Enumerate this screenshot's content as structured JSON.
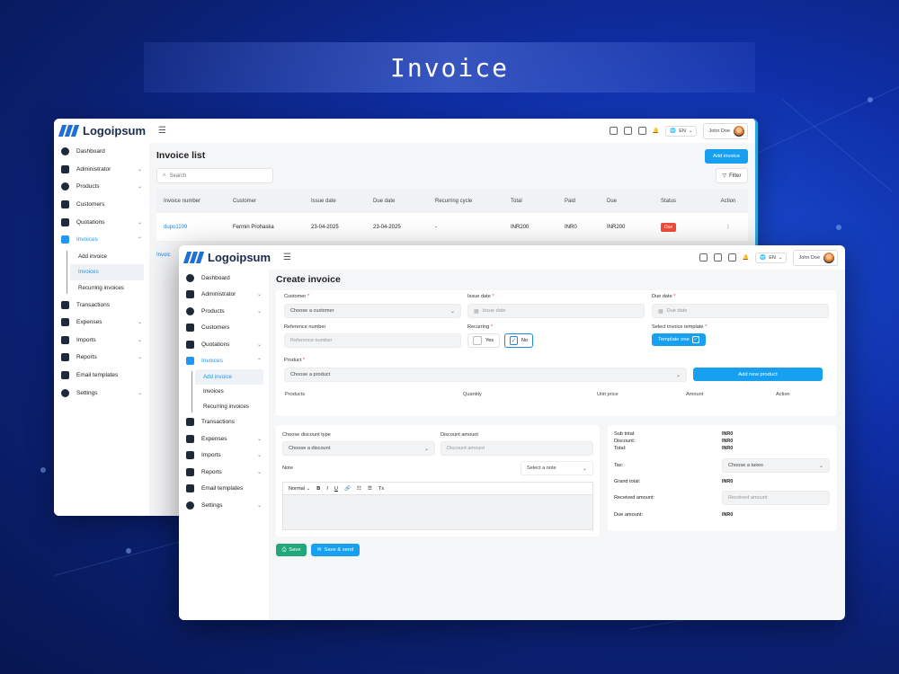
{
  "banner": {
    "title": "Invoice"
  },
  "brand": {
    "name": "Logoipsum",
    "accent": "#18a0f0",
    "logo_color": "#1f6fd6"
  },
  "topbar": {
    "lang": "EN",
    "user": "John Doe"
  },
  "sidebar": {
    "items": [
      {
        "label": "Dashboard",
        "icon": "dashboard-icon"
      },
      {
        "label": "Administrator",
        "icon": "users-icon"
      },
      {
        "label": "Products",
        "icon": "box-icon"
      },
      {
        "label": "Customers",
        "icon": "id-card-icon"
      },
      {
        "label": "Quotations",
        "icon": "clipboard-icon"
      },
      {
        "label": "Invoices",
        "icon": "invoice-icon"
      },
      {
        "label": "Transactions",
        "icon": "card-icon"
      },
      {
        "label": "Expenses",
        "icon": "wallet-icon"
      },
      {
        "label": "Imports",
        "icon": "import-icon"
      },
      {
        "label": "Reports",
        "icon": "report-icon"
      },
      {
        "label": "Email templates",
        "icon": "mail-icon"
      },
      {
        "label": "Settings",
        "icon": "gear-icon"
      }
    ],
    "invoice_sub": [
      "Add invoice",
      "Invoices",
      "Recurring invoices"
    ]
  },
  "invoice_list": {
    "title": "Invoice list",
    "add_button": "Add invoice",
    "search_placeholder": "Search",
    "filter_label": "Filter",
    "columns": [
      "Invoice number",
      "Customer",
      "Issue date",
      "Due date",
      "Recurring cycle",
      "Total",
      "Paid",
      "Due",
      "Status",
      "Action"
    ],
    "rows": [
      {
        "number": "dupo1109",
        "customer": "Fermin Prohaska",
        "issue": "23-04-2025",
        "due_date": "23-04-2025",
        "cycle": "-",
        "total": "INR200",
        "paid": "INR0",
        "due": "INR200",
        "status": "Due"
      }
    ],
    "stub_label": "Invoic"
  },
  "create_invoice": {
    "title": "Create invoice",
    "customer": {
      "label": "Customer",
      "placeholder": "Choose a customer"
    },
    "issue_date": {
      "label": "Issue date",
      "placeholder": "Issue date"
    },
    "due_date": {
      "label": "Due date",
      "placeholder": "Due date"
    },
    "reference": {
      "label": "Reference number",
      "placeholder": "Reference number"
    },
    "recurring": {
      "label": "Recurring",
      "yes": "Yes",
      "no": "No"
    },
    "template": {
      "label": "Select invoice template",
      "value": "Template one"
    },
    "product": {
      "label": "Product",
      "placeholder": "Choose a product",
      "add_button": "Add new product"
    },
    "product_columns": [
      "Products",
      "Quantity",
      "Unit price",
      "Amount",
      "Action"
    ],
    "discount_type": {
      "label": "Choose discount type",
      "placeholder": "Choose a discount"
    },
    "discount_amount": {
      "label": "Discount amount",
      "placeholder": "Discount amount"
    },
    "note": {
      "label": "Note",
      "select": "Select a note"
    },
    "editor": {
      "format": "Normal",
      "bold": "B",
      "italic": "I",
      "underline": "U",
      "clear": "Tx"
    },
    "summary": {
      "sub_total": {
        "label": "Sub total:",
        "value": "INR0"
      },
      "discount": {
        "label": "Discount:",
        "value": "INR0"
      },
      "total": {
        "label": "Total:",
        "value": "INR0"
      },
      "tax": {
        "label": "Tax:",
        "placeholder": "Choose a taxes"
      },
      "grand_total": {
        "label": "Grand total:",
        "value": "INR0"
      },
      "received": {
        "label": "Received amount:",
        "placeholder": "Received amount"
      },
      "due_amount": {
        "label": "Due amount:",
        "value": "INR0"
      }
    },
    "save_button": "Save",
    "save_send_button": "Save & send"
  }
}
